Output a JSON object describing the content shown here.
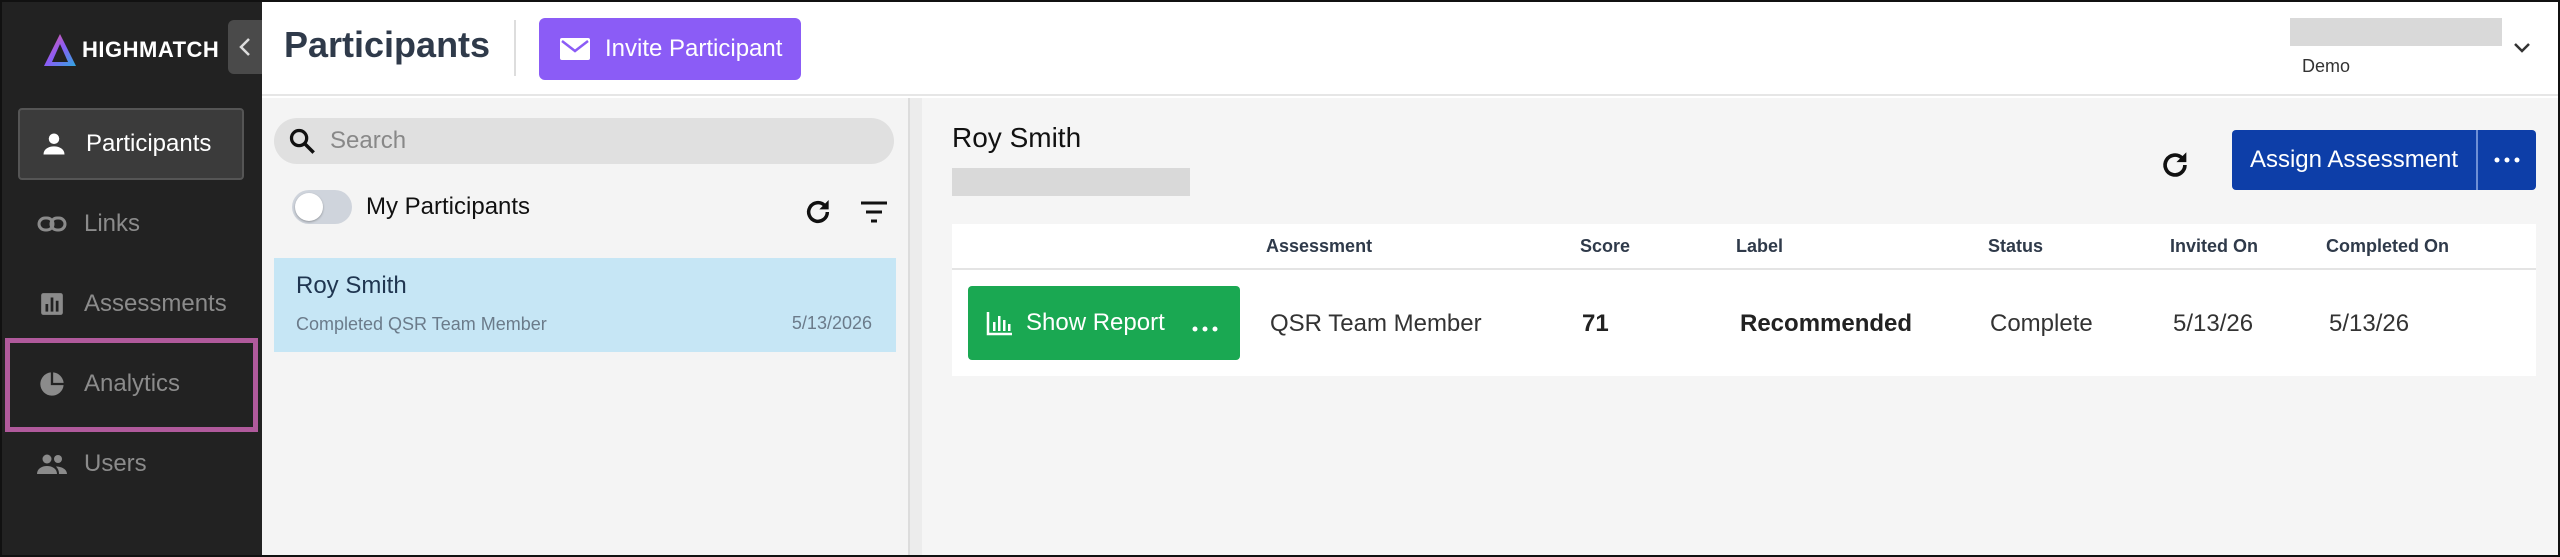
{
  "app": {
    "brand": "HIGHMATCH",
    "page_title": "Participants",
    "invite_label": "Invite Participant",
    "org_label": "Demo"
  },
  "sidebar": {
    "items": [
      {
        "label": "Participants",
        "icon": "person-icon",
        "active": true
      },
      {
        "label": "Links",
        "icon": "link-icon",
        "active": false
      },
      {
        "label": "Assessments",
        "icon": "bar-chart-icon",
        "active": false
      },
      {
        "label": "Analytics",
        "icon": "pie-chart-icon",
        "active": false
      },
      {
        "label": "Users",
        "icon": "group-icon",
        "active": false
      }
    ]
  },
  "list": {
    "search_placeholder": "Search",
    "toggle_label": "My Participants",
    "participants": [
      {
        "name": "Roy Smith",
        "subtitle": "Completed QSR Team Member",
        "date": "5/13/2026"
      }
    ]
  },
  "detail": {
    "name": "Roy Smith",
    "assign_label": "Assign Assessment",
    "columns": [
      "Assessment",
      "Score",
      "Label",
      "Status",
      "Invited On",
      "Completed On"
    ],
    "rows": [
      {
        "action": "Show Report",
        "assessment": "QSR Team Member",
        "score": "71",
        "label": "Recommended",
        "status": "Complete",
        "invited_on": "5/13/26",
        "completed_on": "5/13/26"
      }
    ]
  },
  "colors": {
    "sidebar_bg": "#222222",
    "invite_purple": "#8b5cf6",
    "assign_blue": "#0d3ea8",
    "report_green": "#1aa852",
    "selected_row": "#c6e6f5",
    "highlight_magenta": "#b05a9c"
  }
}
